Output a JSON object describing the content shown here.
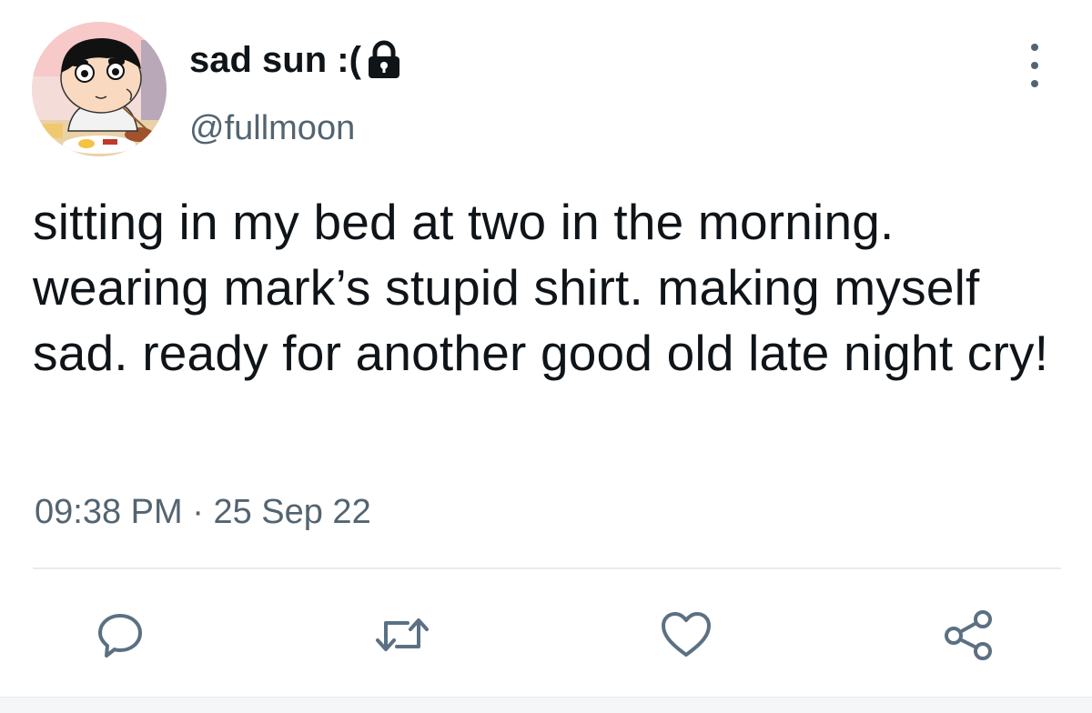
{
  "tweet": {
    "display_name": "sad sun :(",
    "handle": "@fullmoon",
    "text": "sitting in my bed at two in the morning. wearing mark’s stupid shirt. making myself sad. ready for another good old late night cry!",
    "time": "09:38 PM",
    "separator": "·",
    "date": "25 Sep 22"
  },
  "icons": {
    "protected": "lock-icon",
    "more": "more-options-icon",
    "reply": "reply-icon",
    "retweet": "retweet-icon",
    "like": "heart-icon",
    "share": "share-icon"
  },
  "colors": {
    "text": "#0f1419",
    "secondary": "#536471",
    "icon": "#5b7083",
    "divider": "#e6ecf0"
  }
}
